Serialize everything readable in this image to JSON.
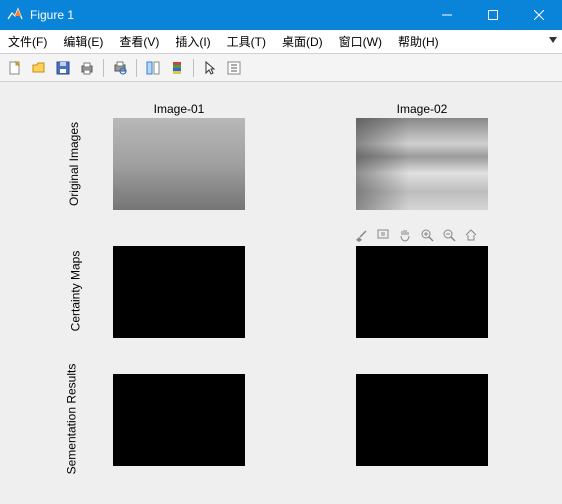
{
  "window": {
    "title": "Figure 1"
  },
  "menu": {
    "items": [
      "文件(F)",
      "编辑(E)",
      "查看(V)",
      "插入(I)",
      "工具(T)",
      "桌面(D)",
      "窗口(W)",
      "帮助(H)"
    ]
  },
  "toolbar": {
    "icons": [
      "new-file-icon",
      "open-icon",
      "save-icon",
      "print-icon",
      "print-preview-icon",
      "link-icon",
      "colorbar-icon",
      "pointer-icon",
      "insert-icon"
    ]
  },
  "figure": {
    "column_titles": [
      "Image-01",
      "Image-02"
    ],
    "row_labels": [
      "Original Images",
      "Certainty Maps",
      "Sementation Results"
    ],
    "axes_toolbar": [
      "brush-icon",
      "datatip-icon",
      "pan-icon",
      "zoom-in-icon",
      "zoom-out-icon",
      "home-icon"
    ]
  }
}
